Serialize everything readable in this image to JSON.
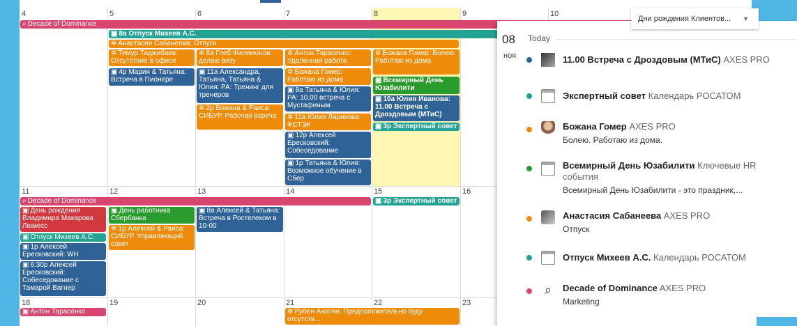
{
  "calendar": {
    "week1": {
      "days": [
        "4",
        "5",
        "6",
        "7",
        "8",
        "9",
        "10"
      ]
    },
    "week2": {
      "days": [
        "11",
        "12",
        "13",
        "14",
        "15",
        "16"
      ]
    },
    "week3": {
      "days": [
        "18",
        "19",
        "20",
        "21",
        "22",
        "23"
      ]
    },
    "events": {
      "decade1": "Decade of Dominance",
      "otpusk_miheev": "8a Отпуск Михеев А.С.",
      "anastasia": "Анастасия Сабанеева: Отпуск",
      "timur": "Тимур Таджибаев: Отсутствие в офисе",
      "mariya": "4p Мария & Татьяна: Встреча в Пионере",
      "gleb": "8a Глеб Филимонов: делаю визу",
      "alexandra": "11a Александра, Татьяна, Татьяна & Юлия: РА: Тренинг для тренеров",
      "bozhana_raisa": "2p Божана & Раиса: СИБУР. Рабочая всреча",
      "anton_w1": "Антон Тарасенко: Удаленная работа",
      "bozhana_w1": "Божана Гомер: Работаю из дома",
      "tatyana_yulia": "8a Татьяна & Юлия: РА: 10.00 встреча с Мустафиным",
      "yulia_larikova": "11a Юлия Ларикова: ФСТЭК",
      "aleksey_12p": "12p Алексей Ересковский: Собеседование",
      "tatyana_1p": "1p Татьяна & Юлия: Возможное обучение в Сбер",
      "bozhana_8": "Божана Гомер: Болею. Работаю из дома.",
      "usability": "Всемирный День Юзабилити",
      "yulia_ivanova": "10a Юлия Иванова: 11.00 Встреча с Дроздовым (МТиС)",
      "expert_8": "3p Экспертный совет",
      "decade2": "Decade of Dominance",
      "expert_15": "3p Экспертный совет",
      "birthday": "День рождения Владимира Макарова Люмесс",
      "otpusk_w2": "Отпуск Михеев А.С.",
      "aleksey_wh": "1p Алексей Ересковский: WH",
      "aleksey_630": "6:30p Алексей Ересковский: Собеседование с Тамарой Вагнер",
      "sberbank": "День работника Сбербанка",
      "aleksey_raisa": "1p Алексей & Раиса: СИБУР. Управляющий совет",
      "aleksey_tatyana": "8a Алексей & Татьяна: Встреча в Ростелеком в 10-00",
      "anton_18": "Антон Тарасенко",
      "ruben": "Рубен Акопян: Предположительно буду отсутств..."
    }
  },
  "dropdown": {
    "label": "Дни рождения Клиентов..."
  },
  "panel": {
    "day": "08",
    "month": "ноя",
    "today_label": "Today",
    "items": [
      {
        "title": "11.00 Встреча с Дроздовым (МТиС)",
        "source": "AXES PRO",
        "sub": "",
        "dot": "#2f6398",
        "icon": "avatar-icon"
      },
      {
        "title": "Экспертный совет",
        "source": "Календарь РОСАТОМ",
        "sub": "",
        "dot": "#23a393",
        "icon": "calendar-icon"
      },
      {
        "title": "Божана Гомер",
        "source": "AXES PRO",
        "sub": "Болею. Работаю из дома.",
        "dot": "#ee8c0a",
        "icon": "avatar-icon"
      },
      {
        "title": "Всемирный День Юзабилити",
        "source": "Ключевые HR",
        "source2": "события",
        "sub": "Всемирный День Юзабилити - это праздник,...",
        "dot": "#2a9b2d",
        "icon": "calendar-icon"
      },
      {
        "title": "Анастасия Сабанеева",
        "source": "AXES PRO",
        "sub": "Отпуск",
        "dot": "#ee8c0a",
        "icon": "avatar-icon"
      },
      {
        "title": "Отпуск Михеев А.С.",
        "source": "Календарь РОСАТОМ",
        "sub": "",
        "dot": "#23a393",
        "icon": "calendar-icon"
      },
      {
        "title": "Decade of Dominance",
        "source": "AXES PRO",
        "sub": "Marketing",
        "dot": "#d8456e",
        "icon": "search-icon"
      }
    ]
  }
}
